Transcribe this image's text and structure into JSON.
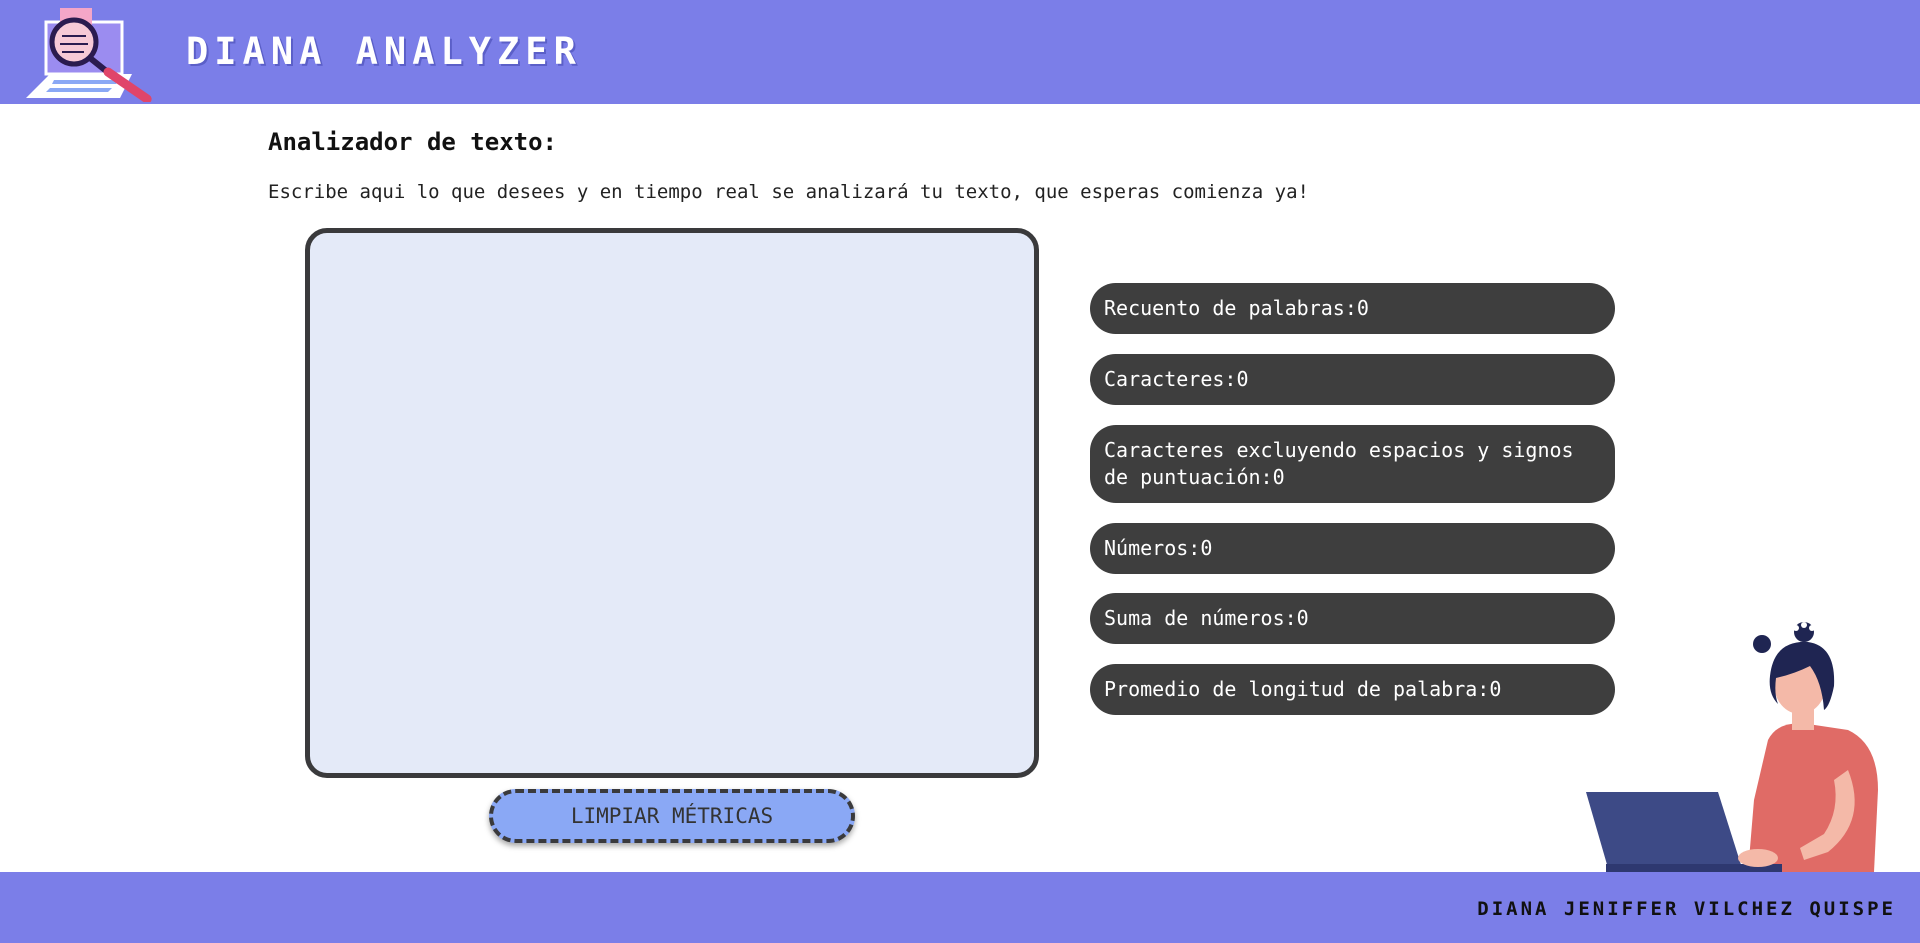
{
  "header": {
    "brand": "DIANA ANALYZER",
    "logo_icon": "laptop-magnifier-icon"
  },
  "main": {
    "title": "Analizador de texto:",
    "instructions": "Escribe aqui lo que desees y en tiempo real se analizará tu texto, que esperas comienza ya!",
    "textarea_value": "",
    "clear_button": "LIMPIAR MÉTRICAS"
  },
  "metrics": [
    {
      "label": "Recuento de palabras:",
      "value": "0"
    },
    {
      "label": "Caracteres:",
      "value": "0"
    },
    {
      "label": "Caracteres excluyendo espacios y signos de puntuación:",
      "value": "0"
    },
    {
      "label": "Números:",
      "value": "0"
    },
    {
      "label": "Suma de números:",
      "value": "0"
    },
    {
      "label": "Promedio de longitud de palabra:",
      "value": "0"
    }
  ],
  "illustration": {
    "icon": "woman-with-laptop-illustration"
  },
  "footer": {
    "author": "DIANA JENIFFER VILCHEZ QUISPE"
  },
  "colors": {
    "header_bg": "#7b7ee8",
    "textarea_bg": "#e4eaf8",
    "button_bg": "#8aa8f5",
    "metric_bg": "#3e3e3e"
  }
}
